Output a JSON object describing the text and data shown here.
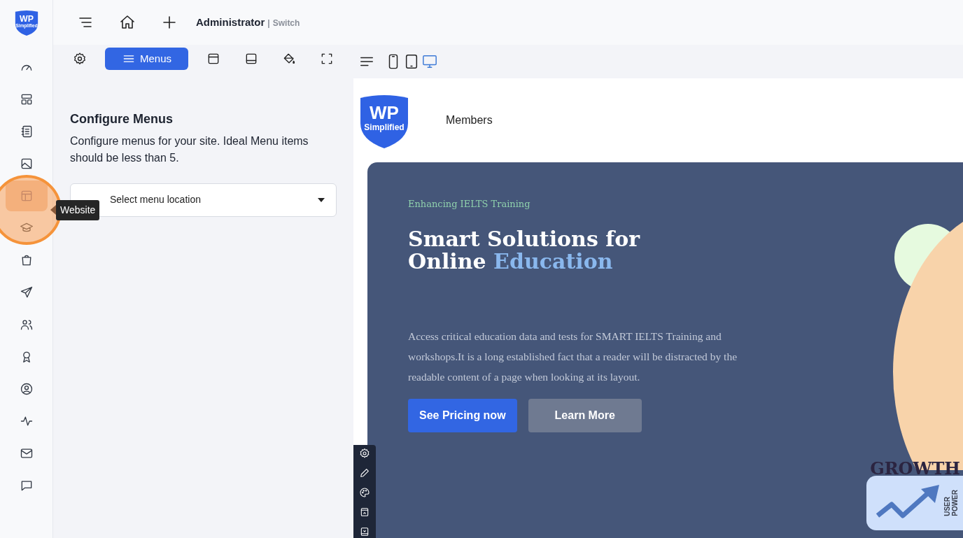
{
  "logo": {
    "text": "WP",
    "subtext": "Simplified"
  },
  "rail": [
    {
      "kind": "gauge",
      "selected": false
    },
    {
      "kind": "templates",
      "selected": false
    },
    {
      "kind": "notebook",
      "selected": false
    },
    {
      "kind": "image",
      "selected": false
    },
    {
      "kind": "website",
      "selected": true
    },
    {
      "kind": "cap",
      "selected": false
    },
    {
      "kind": "bag",
      "selected": false
    },
    {
      "kind": "send",
      "selected": false
    },
    {
      "kind": "users",
      "selected": false
    },
    {
      "kind": "award",
      "selected": false
    },
    {
      "kind": "profile",
      "selected": false
    },
    {
      "kind": "activity",
      "selected": false
    },
    {
      "kind": "mail",
      "selected": false
    },
    {
      "kind": "chat",
      "selected": false
    }
  ],
  "tooltip": {
    "text": "Website"
  },
  "topbar": {
    "user": "Administrator",
    "separator": "|",
    "switch": "Switch"
  },
  "tabs": [
    {
      "kind": "gear",
      "selected": false
    },
    {
      "kind": "hamburger",
      "label": "Menus",
      "selected": true
    },
    {
      "kind": "header",
      "selected": false
    },
    {
      "kind": "footer",
      "selected": false
    },
    {
      "kind": "paint",
      "selected": false
    },
    {
      "kind": "fullscreen",
      "selected": false
    }
  ],
  "devices": [
    {
      "kind": "phone",
      "selected": false
    },
    {
      "kind": "tablet",
      "selected": false
    },
    {
      "kind": "desktop",
      "selected": true
    }
  ],
  "panel": {
    "title": "Configure Menus",
    "description": "Configure menus for your site. Ideal Menu items should be less than 5.",
    "select": {
      "placeholder": "Select menu location"
    }
  },
  "preview": {
    "logo": {
      "text": "WP",
      "subtext": "Simplified"
    },
    "nav": [
      "Members"
    ],
    "hero": {
      "eyebrow": "Enhancing IELTS Training",
      "line1": "Smart Solutions for",
      "line2": "Online",
      "highlight": "Education",
      "paragraph": "Access critical education data and tests for SMART IELTS Training and workshops.It is a long established fact that a reader will be distracted by the readable content of a page when looking at its layout.",
      "buttons": [
        {
          "label": "See Pricing now",
          "kind": "primary"
        },
        {
          "label": "Learn More",
          "kind": "secondary"
        }
      ],
      "illustration": {
        "title": "GROWTH",
        "card_lines": [
          "USER",
          "POWER"
        ]
      }
    }
  }
}
